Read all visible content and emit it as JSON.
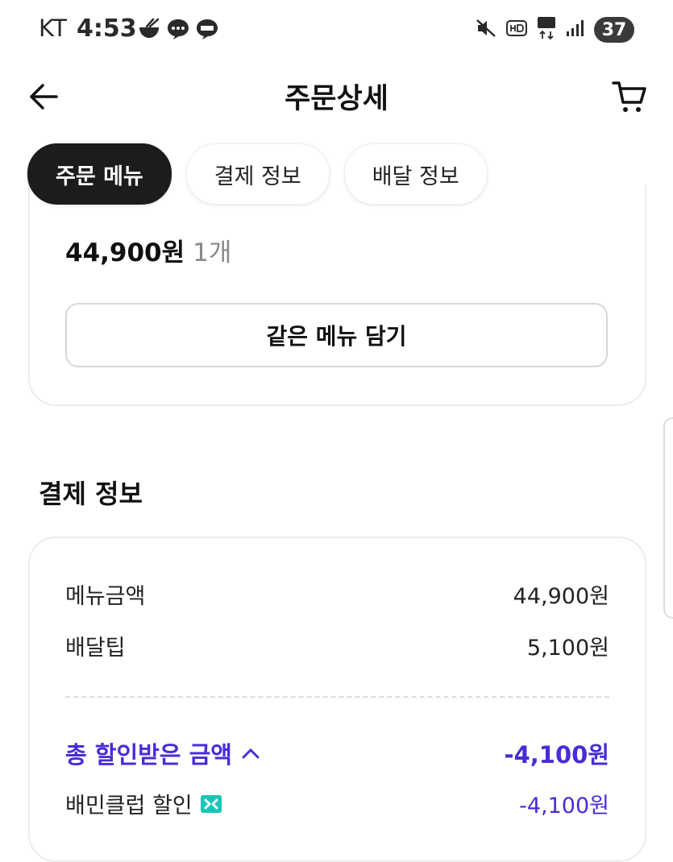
{
  "status_bar": {
    "carrier": "KT",
    "time": "4:53",
    "battery": "37"
  },
  "header": {
    "title": "주문상세"
  },
  "tabs": [
    {
      "label": "주문 메뉴",
      "active": true
    },
    {
      "label": "결제 정보",
      "active": false
    },
    {
      "label": "배달 정보",
      "active": false
    }
  ],
  "menu_item": {
    "price": "44,900원",
    "quantity": "1개",
    "same_menu_button": "같은 메뉴 담기"
  },
  "payment": {
    "section_title": "결제 정보",
    "menu_amount_label": "메뉴금액",
    "menu_amount_value": "44,900원",
    "delivery_tip_label": "배달팁",
    "delivery_tip_value": "5,100원",
    "total_discount_label": "총 할인받은 금액",
    "total_discount_value": "-4,100원",
    "club_discount_label": "배민클럽 할인",
    "club_discount_value": "-4,100원"
  },
  "colors": {
    "accent": "#4a2cd6",
    "club_badge": "#16c7b8",
    "active_tab": "#1c1c1c"
  }
}
